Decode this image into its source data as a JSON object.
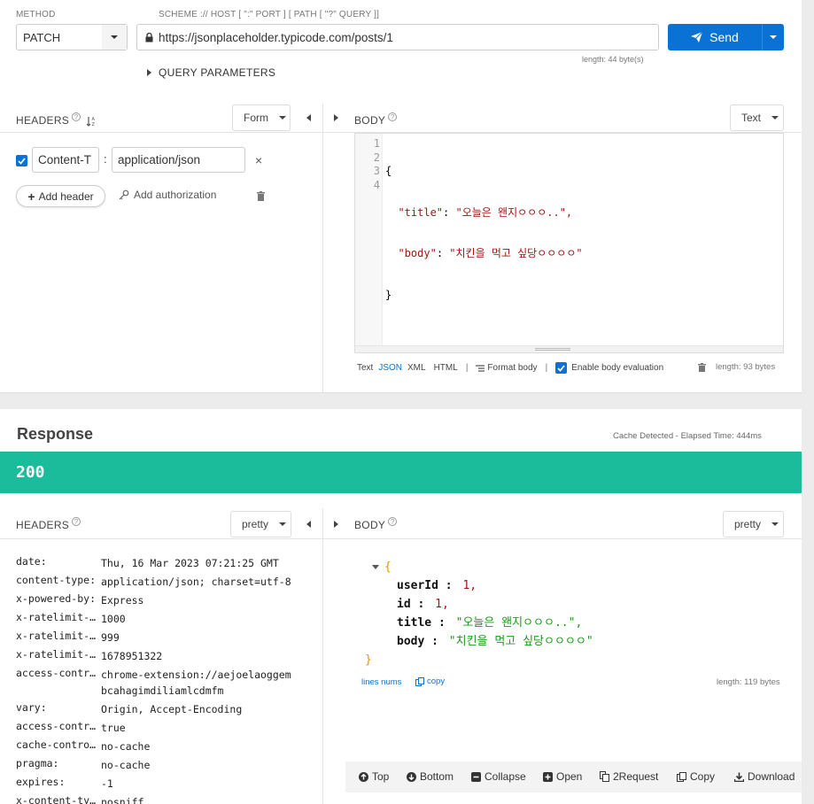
{
  "request": {
    "method_label": "METHOD",
    "method_value": "PATCH",
    "url_label": "SCHEME :// HOST [ \":\" PORT ] [ PATH [ \"?\" QUERY ]]",
    "url_value": "https://jsonplaceholder.typicode.com/posts/1",
    "url_length": "length: 44 byte(s)",
    "send_label": "Send",
    "query_params_label": "QUERY PARAMETERS",
    "headers_title": "HEADERS",
    "headers_mode": "Form",
    "header_name": "Content-T",
    "header_value": "application/json",
    "add_header_label": "Add header",
    "add_auth_label": "Add authorization",
    "body_title": "BODY",
    "body_mode": "Text",
    "body_lines": [
      {
        "num": "1",
        "text": "{"
      },
      {
        "num": "2",
        "key": "\"title\"",
        "val": "\"오늘은 왠지ㅇㅇㅇ..\","
      },
      {
        "num": "3",
        "key": "\"body\"",
        "val": "\"치킨을 먹고 싶당ㅇㅇㅇㅇ\""
      },
      {
        "num": "4",
        "text": "}"
      }
    ],
    "body_format_text": "Text",
    "body_format_json": "JSON",
    "body_format_xml": "XML",
    "body_format_html": "HTML",
    "format_body_label": "Format body",
    "enable_eval_label": "Enable body evaluation",
    "body_length": "length: 93 bytes"
  },
  "response": {
    "title": "Response",
    "cache_info": "Cache Detected - Elapsed Time: 444ms",
    "status_code": "200",
    "status_color": "#1abc9c",
    "headers_title": "HEADERS",
    "headers_mode": "pretty",
    "body_title": "BODY",
    "body_mode": "pretty",
    "headers": [
      {
        "key": "date:",
        "value": "Thu, 16 Mar 2023 07:21:25 GMT"
      },
      {
        "key": "content-type:",
        "value": "application/json; charset=utf-8"
      },
      {
        "key": "x-powered-by:",
        "value": "Express"
      },
      {
        "key": "x-ratelimit-l…",
        "value": "1000"
      },
      {
        "key": "x-ratelimit-r…",
        "value": "999"
      },
      {
        "key": "x-ratelimit-r…",
        "value": "1678951322"
      },
      {
        "key": "access-contro…",
        "value": "chrome-extension://aejoelaoggembcahagimdiliamlcdmfm"
      },
      {
        "key": "vary:",
        "value": "Origin, Accept-Encoding"
      },
      {
        "key": "access-contro…",
        "value": "true"
      },
      {
        "key": "cache-control:",
        "value": "no-cache"
      },
      {
        "key": "pragma:",
        "value": "no-cache"
      },
      {
        "key": "expires:",
        "value": "-1"
      },
      {
        "key": "x-content-typ…",
        "value": "nosniff"
      }
    ],
    "json": {
      "open": "{",
      "close": "}",
      "fields": [
        {
          "key": "userId :",
          "value": "1,",
          "type": "number"
        },
        {
          "key": "id :",
          "value": "1,",
          "type": "number"
        },
        {
          "key": "title :",
          "value": "\"오늘은 왠지ㅇㅇㅇ..\",",
          "type": "string"
        },
        {
          "key": "body :",
          "value": "\"치킨을 먹고 싶당ㅇㅇㅇㅇ\"",
          "type": "string"
        }
      ]
    },
    "lines_nums_label": "lines nums",
    "copy_label": "copy",
    "body_length": "length: 119 bytes"
  },
  "toolbar": {
    "top": "Top",
    "bottom": "Bottom",
    "collapse": "Collapse",
    "open": "Open",
    "to_request": "2Request",
    "copy": "Copy",
    "download": "Download"
  },
  "colors": {
    "accent": "#0a72d4",
    "status": "#1abc9c",
    "string_red": "#a31515",
    "json_green": "#1a9b1a"
  }
}
